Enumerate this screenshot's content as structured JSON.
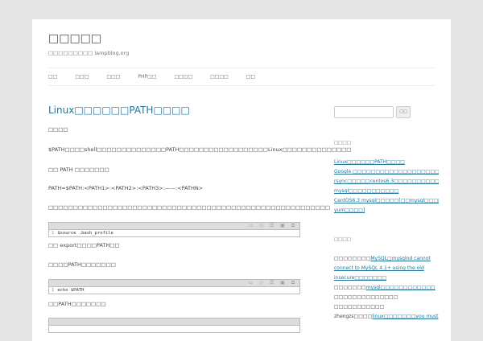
{
  "site": {
    "title": "□□□□□",
    "tagline": "□□□□□□□□□ lampblog.org"
  },
  "nav": [
    "□□",
    "□□□",
    "□□□",
    "PHP□□",
    "□□□□",
    "□□□□",
    "□□"
  ],
  "post": {
    "title": "Linux□□□□□□PATH□□□□",
    "paragraphs": [
      "□□□□",
      "$PATH□□□□shell□□□□□□□□□□□□□□PATH□□□□□□□□□□□□□□□□□□Linux□□□□□□□□□□□□□□",
      "□□ PATH □□□□□□□",
      "PATH=$PATH:<PATH1>:<PATH2>:<PATH3>:——:<PATHN>",
      "□□□□□□□□□□□□□□□□□□□□□□□□□□□□□□□□□□□□□□□□□□□□□□□□□□□□□□□□□"
    ],
    "code1": {
      "line_no": "1",
      "text": "$source .bash_profile"
    },
    "after1": "□□ export□□□□PATH□□",
    "after1b": "□□□□PATH□□□□□□□",
    "code2": {
      "line_no": "1",
      "text": "echo $PATH"
    },
    "after2": "□□PATH□□□□□□□",
    "code_tools": "▭ ◇ ☰ ▣ ⧉"
  },
  "sidebar": {
    "search_button": "□□",
    "recent_heading": "□□□□",
    "recent": [
      "Linux□□□□□□PATH□□□□",
      "Google □□□□□□□□□□□□□□□□□□□□□□□[□]",
      "rsync□□□□□centos6.3□□□□□□□□□□□□",
      "mysql□□□□□□□□□□□",
      "CentOS6.3 mysql□□□□□[□□mysql□□□□",
      "yum□□□□]"
    ],
    "comments_heading": "□□□□",
    "comments": [
      {
        "author": "□□□□□□□□",
        "link": "MySQL□mysqlnd cannot connect to MySQL 4.1+ using the old insecure□□□□□□□"
      },
      {
        "author": "□□□□□□□",
        "link": "mysql□□□□□□□□□□□□"
      },
      {
        "author": "□□□□□□□□□□□□□□",
        "link": ""
      },
      {
        "author": "□□□□□□□□□□□",
        "link": ""
      },
      {
        "author": "zhengzs□□□□",
        "link": "linux□□□□□□□you must"
      }
    ]
  }
}
